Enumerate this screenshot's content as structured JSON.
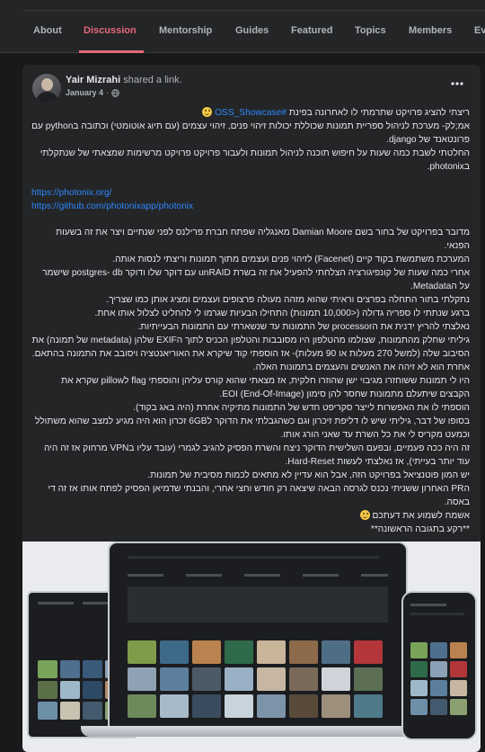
{
  "tabs": [
    {
      "label": "About",
      "active": false
    },
    {
      "label": "Discussion",
      "active": true
    },
    {
      "label": "Mentorship",
      "active": false
    },
    {
      "label": "Guides",
      "active": false
    },
    {
      "label": "Featured",
      "active": false
    },
    {
      "label": "Topics",
      "active": false
    },
    {
      "label": "Members",
      "active": false
    },
    {
      "label": "Ev",
      "active": false
    }
  ],
  "post": {
    "author": "Yair Mizrahi",
    "action": "shared a link.",
    "date": "January 4",
    "dot": "·",
    "privacy_icon": "globe-icon",
    "more_icon": "more-icon",
    "lines": {
      "l1_pre": "ריצתי להציג פרויקט שתרמתי לו לאחרונה בפינת ",
      "l1_tag": "#OSS_Showcase",
      "l2": "אמ;לק- מערכת לניהול ספריית תמונות שכוללת יכולות זיהוי פנים, זיהוי עצמים (עם תיוג אוטומטי) וכתובה בpython עם פרונטאנד של django.",
      "l3": "החלטתי לשבת כמה שעות על חיפוש תוכנה לניהול תמונות ולעבור פרויקט פרויקט מרשימות שמצאתי של שנתקלתי בphotonix.",
      "link1": "https://photonix.org/",
      "link2": "https://github.com/photonixapp/photonix",
      "l4": "מדובר בפרויקט של בחור בשם Damian Moore מאנגליה שפתח חברת פרילנס לפני שנתיים ויצר את זה בשעות הפנאי.",
      "l5": "המערכת משתמשת בקוד קיים (Facenet) לזיהוי פנים ועצמים מתוך תמונות וריצתי לנסות אותה.",
      "l6": "אחרי כמה שעות של קונפיגורציה הצלחתי להפעיל את זה בשרת unRAID עם דוקר שלו ודוקר postgres- db שישמר על הMetadata.",
      "l7": "נתקלתי בתור התחלה בפרצים וראיתי שהוא מזהה מעולה פרצופים ועצמים ומציג אותן כמו שצריך.",
      "l8": "ברגע שנתתי לו ספריה גדולה (<10,000 תמונות) התחילו הבעיות שגרמו לי להחליט לצלול אותו אחת.",
      "l9": "נאלצתי להריץ ידנית את הprocessor של התמונות עד שנשארתי עם התמונות הבעייתיות.",
      "l10": "גיליתי שחלק מהתמונות, שצולמו מהטלפון היו מסובבות והטלפון הכניס לתוך הEXIF שלהן (metadata של תמונה) את הסיבוב שלה (למשל 270 מעלות או 90 מעלות)- אז הוספתי קוד שיקרא את האוריאנטציה ויסובב את התמונה בהתאם.",
      "l11": "אחרת הוא לא זיהה את האנשים והעצמים בתמונות האלה.",
      "l12": "היו לי תמונות ששוחזרו מגיבוי ישן שהוזרו חלקית, אז מצאתי שהוא קורס עליהן והוספתי flag לpillow שקרא את הקבצים שיתעלם מתמונות שחסר להן סימון EOI (End-Of-Image).",
      "l13": "הוספתי לו את האפשרות לייצר סקריפט חדש של התמונות מתיקיה אחרת (היה באג בקוד).",
      "l14": "בסופו של דבר, גיליתי שיש לו דליפת זיכרון וגם כשהגבלתי את הדוקר ל6GB זכרון הוא היה מגיע למצב שהוא משתולל וכמעט מקריס לי את כל השרת עד שאני הורג אותו.",
      "l15": "זה היה ככה פעמיים, ובפעם השלישית הדוקר ניצח והשרת הפסיק להגיב לגמרי (עובד עליו בVPN מרחוק אז זה היה עוד יותר בעייתי), אז נאלצתי לעשות Hard-Reset.",
      "l16": "יש המון פוטנציאל בפרויקט הזה, אבל הוא עדיין לא מתאים לכמות מסיבית של תמונות.",
      "l17": "הPR האחרון ששניתי נכנס לגרסה הבאה שיצאה רק חודש וחצי אחרי, והבנתי שדמיאן הפסיק לפתח אותו אז זה די באסה.",
      "l18_pre": "אשמח לשמוע את דעתכם ",
      "l19": "**רקע בתגובה הראשונה**"
    }
  },
  "colors": {
    "accent": "#e4687a",
    "link": "#2d88ff",
    "card": "#242526",
    "page": "#18191a"
  }
}
